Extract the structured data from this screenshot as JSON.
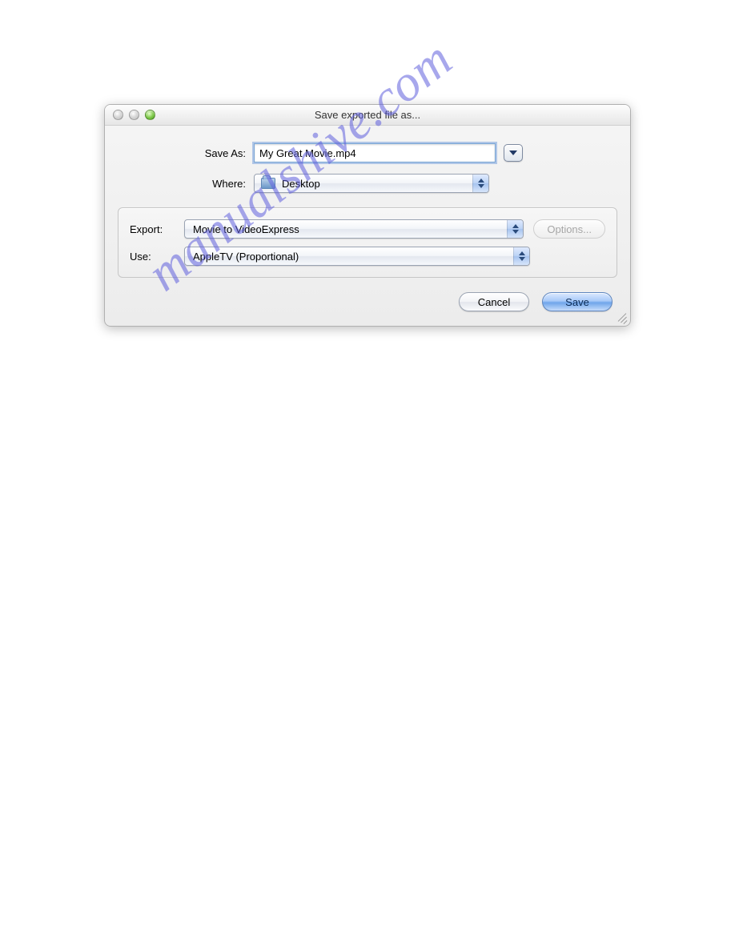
{
  "window": {
    "title": "Save exported file as..."
  },
  "labels": {
    "save_as": "Save As:",
    "where": "Where:",
    "export": "Export:",
    "use": "Use:"
  },
  "fields": {
    "filename": "My Great Movie.mp4",
    "where_selected": "Desktop",
    "export_selected": "Movie to VideoExpress",
    "use_selected": "AppleTV (Proportional)"
  },
  "buttons": {
    "options": "Options...",
    "cancel": "Cancel",
    "save": "Save"
  },
  "watermark": "manualshive.com"
}
